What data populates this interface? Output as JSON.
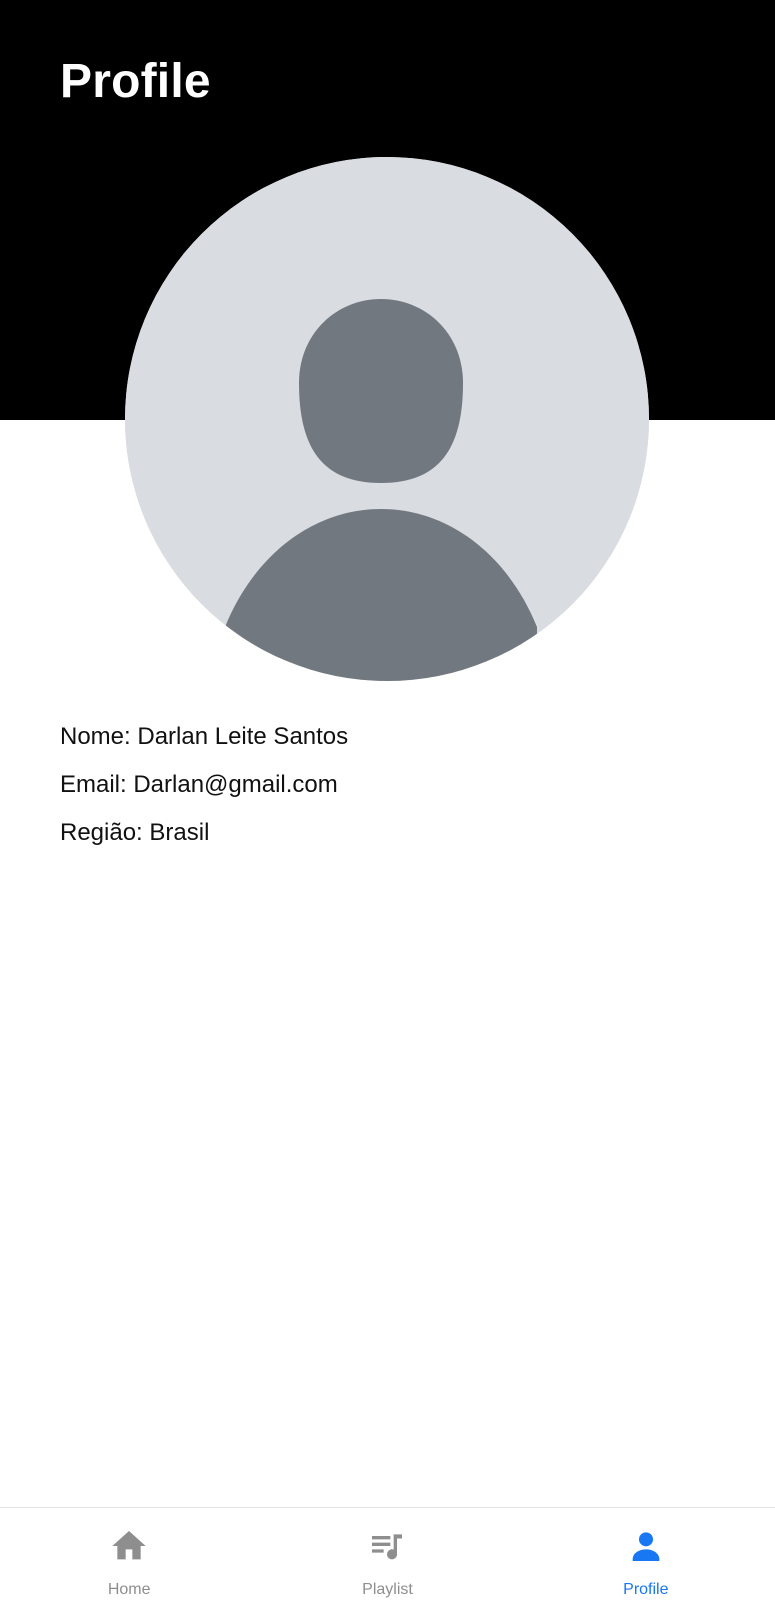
{
  "header": {
    "title": "Profile",
    "background": "#000000"
  },
  "avatar": {
    "icon": "person-placeholder-icon",
    "background": "#d9dce1",
    "figure_color": "#72787f"
  },
  "profile": {
    "name_line": "Nome: Darlan Leite Santos",
    "email_line": "Email: Darlan@gmail.com",
    "region_line": "Região: Brasil"
  },
  "bottom_nav": {
    "active_color": "#1877f2",
    "inactive_color": "#8e8e8e",
    "items": [
      {
        "label": "Home",
        "icon": "home-icon",
        "active": false
      },
      {
        "label": "Playlist",
        "icon": "playlist-icon",
        "active": false
      },
      {
        "label": "Profile",
        "icon": "person-icon",
        "active": true
      }
    ]
  }
}
